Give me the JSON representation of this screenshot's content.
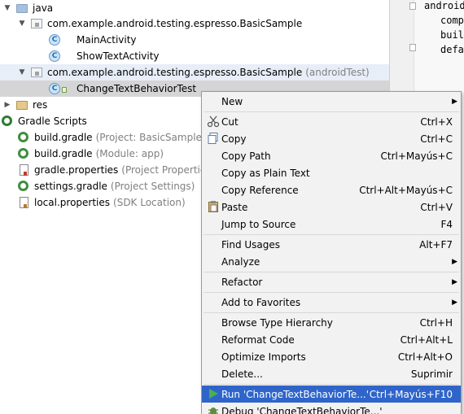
{
  "tree": {
    "items": [
      {
        "label": "java",
        "hint": ""
      },
      {
        "label": "com.example.android.testing.espresso.BasicSample",
        "hint": ""
      },
      {
        "label": "MainActivity",
        "hint": ""
      },
      {
        "label": "ShowTextActivity",
        "hint": ""
      },
      {
        "label": "com.example.android.testing.espresso.BasicSample",
        "hint": "(androidTest)"
      },
      {
        "label": "ChangeTextBehaviorTest",
        "hint": ""
      },
      {
        "label": "res",
        "hint": ""
      },
      {
        "label": "Gradle Scripts",
        "hint": ""
      },
      {
        "label": "build.gradle",
        "hint": "(Project: BasicSample)"
      },
      {
        "label": "build.gradle",
        "hint": "(Module: app)"
      },
      {
        "label": "gradle.properties",
        "hint": "(Project Properties)"
      },
      {
        "label": "settings.gradle",
        "hint": "(Project Settings)"
      },
      {
        "label": "local.properties",
        "hint": "(SDK Location)"
      }
    ]
  },
  "editor": {
    "lines": [
      "android",
      "comp",
      "buil",
      "defa"
    ]
  },
  "menu": {
    "items": [
      {
        "label": "New",
        "shortcut": "",
        "submenu": true
      },
      {
        "label": "Cut",
        "shortcut": "Ctrl+X"
      },
      {
        "label": "Copy",
        "shortcut": "Ctrl+C"
      },
      {
        "label": "Copy Path",
        "shortcut": "Ctrl+Mayús+C"
      },
      {
        "label": "Copy as Plain Text",
        "shortcut": ""
      },
      {
        "label": "Copy Reference",
        "shortcut": "Ctrl+Alt+Mayús+C"
      },
      {
        "label": "Paste",
        "shortcut": "Ctrl+V"
      },
      {
        "label": "Jump to Source",
        "shortcut": "F4"
      },
      {
        "label": "Find Usages",
        "shortcut": "Alt+F7"
      },
      {
        "label": "Analyze",
        "shortcut": "",
        "submenu": true
      },
      {
        "label": "Refactor",
        "shortcut": "",
        "submenu": true
      },
      {
        "label": "Add to Favorites",
        "shortcut": "",
        "submenu": true
      },
      {
        "label": "Browse Type Hierarchy",
        "shortcut": "Ctrl+H"
      },
      {
        "label": "Reformat Code",
        "shortcut": "Ctrl+Alt+L"
      },
      {
        "label": "Optimize Imports",
        "shortcut": "Ctrl+Alt+O"
      },
      {
        "label": "Delete...",
        "shortcut": "Suprimir"
      },
      {
        "label": "Run 'ChangeTextBehaviorTe...'",
        "shortcut": "Ctrl+Mayús+F10"
      },
      {
        "label": "Debug 'ChangeTextBehaviorTe...'",
        "shortcut": ""
      }
    ]
  },
  "colors": {
    "selection": "#2f65ca",
    "selected_row": "#d5d5d5",
    "highlight_row": "#e8eef8"
  }
}
